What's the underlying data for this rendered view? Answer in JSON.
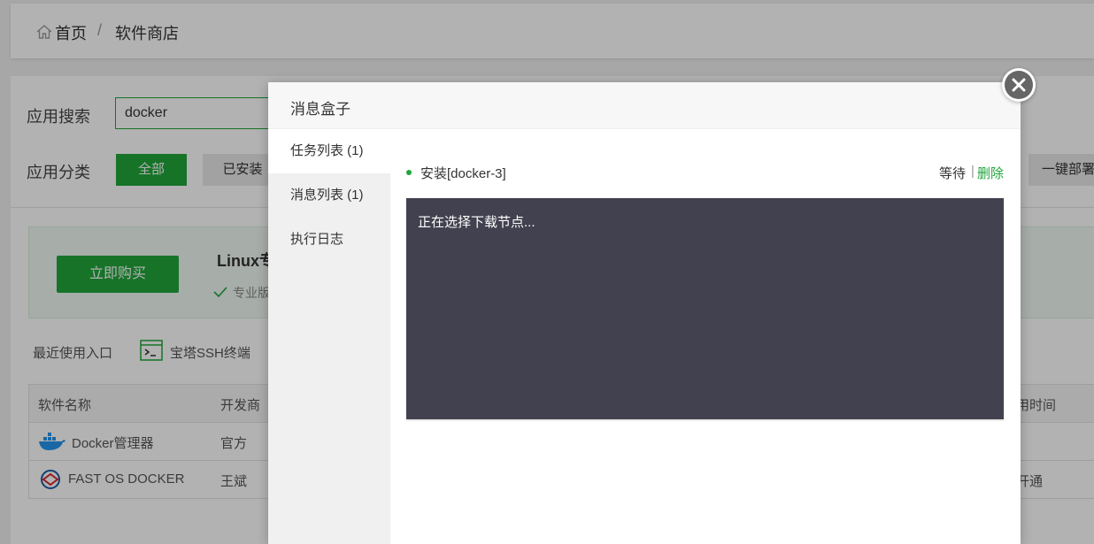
{
  "breadcrumb": {
    "home": "首页",
    "separator": "/",
    "current": "软件商店"
  },
  "search": {
    "label": "应用搜索",
    "value": "docker"
  },
  "category": {
    "label": "应用分类",
    "all": "全部",
    "installed": "已安装",
    "deploy": "一键部署"
  },
  "promo": {
    "buy_button": "立即购买",
    "title": "Linux专",
    "subtitle": "专业版"
  },
  "recent": {
    "label": "最近使用入口",
    "ssh": "宝塔SSH终端"
  },
  "table": {
    "headers": {
      "name": "软件名称",
      "developer": "开发商",
      "time": "用时间"
    },
    "rows": [
      {
        "name": "Docker管理器",
        "developer": "官方",
        "time": ""
      },
      {
        "name": "FAST OS DOCKER",
        "developer": "王斌",
        "time": "开通"
      }
    ]
  },
  "modal": {
    "title": "消息盒子",
    "tabs": [
      "任务列表 (1)",
      "消息列表 (1)",
      "执行日志"
    ],
    "task": {
      "name": "安装[docker-3]",
      "status": "等待",
      "separator": "|",
      "delete": "删除"
    },
    "console_text": "正在选择下载节点..."
  },
  "colors": {
    "accent": "#20a53a",
    "console_bg": "#42414f"
  }
}
